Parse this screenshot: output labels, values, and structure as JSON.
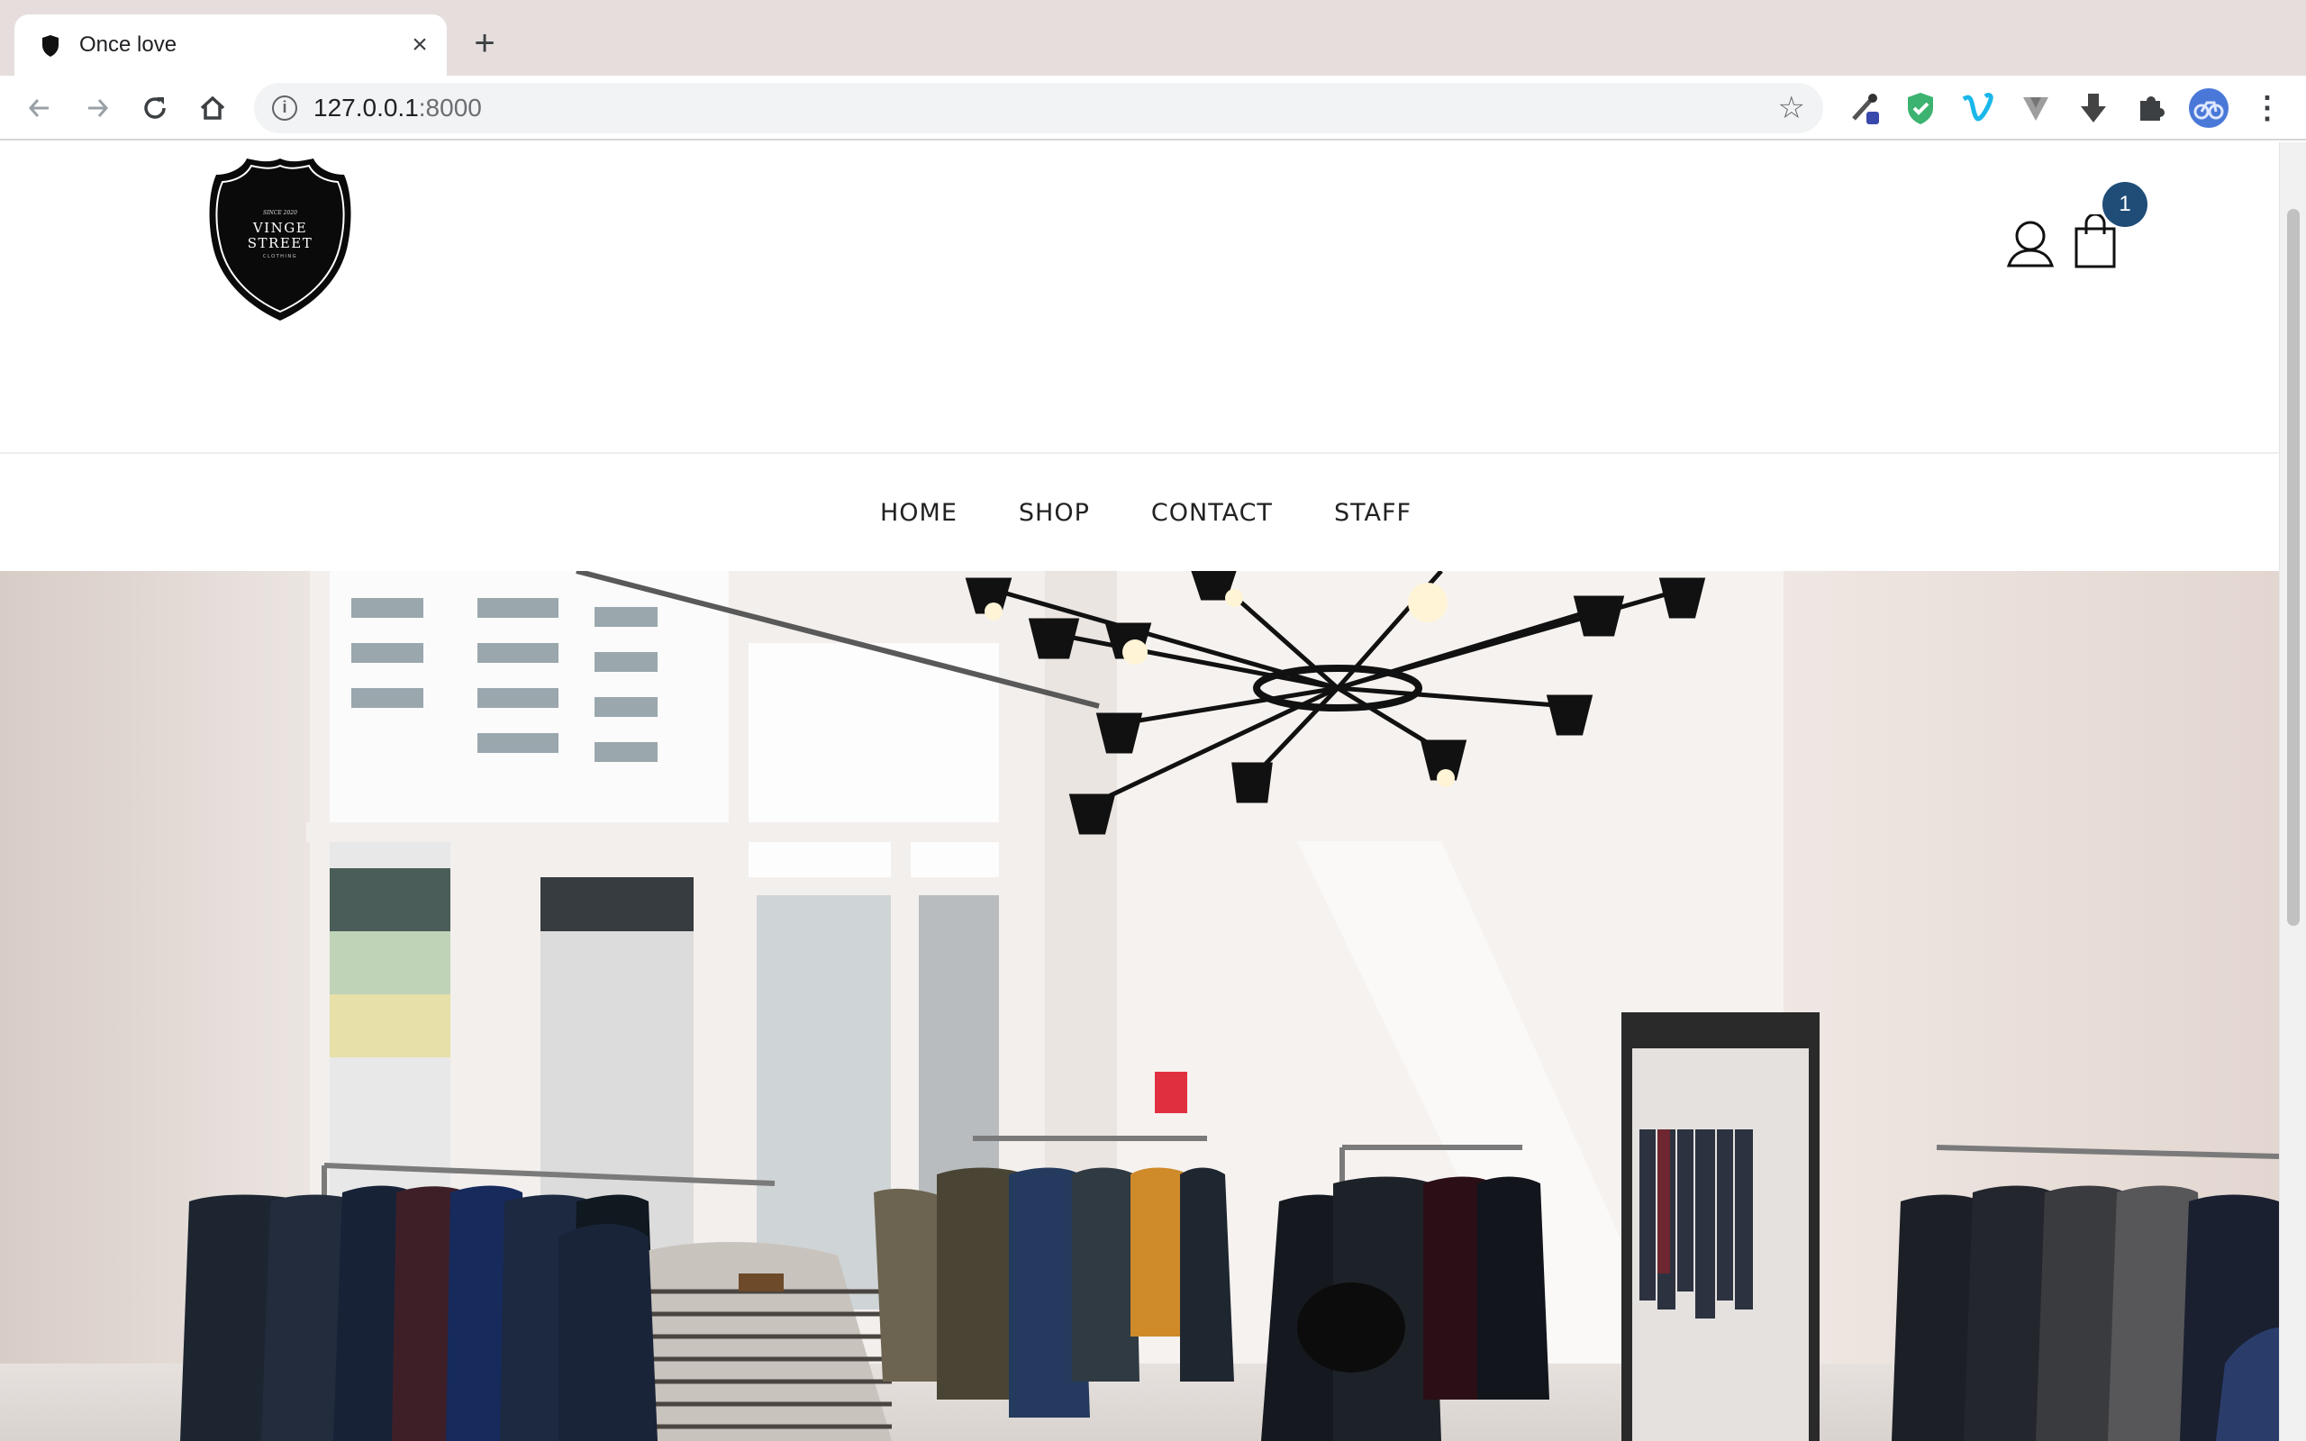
{
  "browser": {
    "tab_title": "Once love",
    "new_tab_icon": "plus-icon",
    "url_host": "127.0.0.1",
    "url_port": ":8000",
    "extensions": [
      "eyedropper-icon",
      "shield-check-icon",
      "vimeo-icon",
      "vuetify-icon",
      "download-arrow-icon",
      "puzzle-icon"
    ]
  },
  "site": {
    "logo": {
      "small_text": "SINCE 2020",
      "line1": "VINGE",
      "line2": "STREET",
      "line3": "CLOTHING"
    },
    "cart_count": "1",
    "nav": [
      "HOME",
      "SHOP",
      "CONTACT",
      "STAFF"
    ]
  },
  "colors": {
    "tabstrip": "#e5dedd",
    "badge": "#1f4d78",
    "nav_text": "#222222"
  }
}
